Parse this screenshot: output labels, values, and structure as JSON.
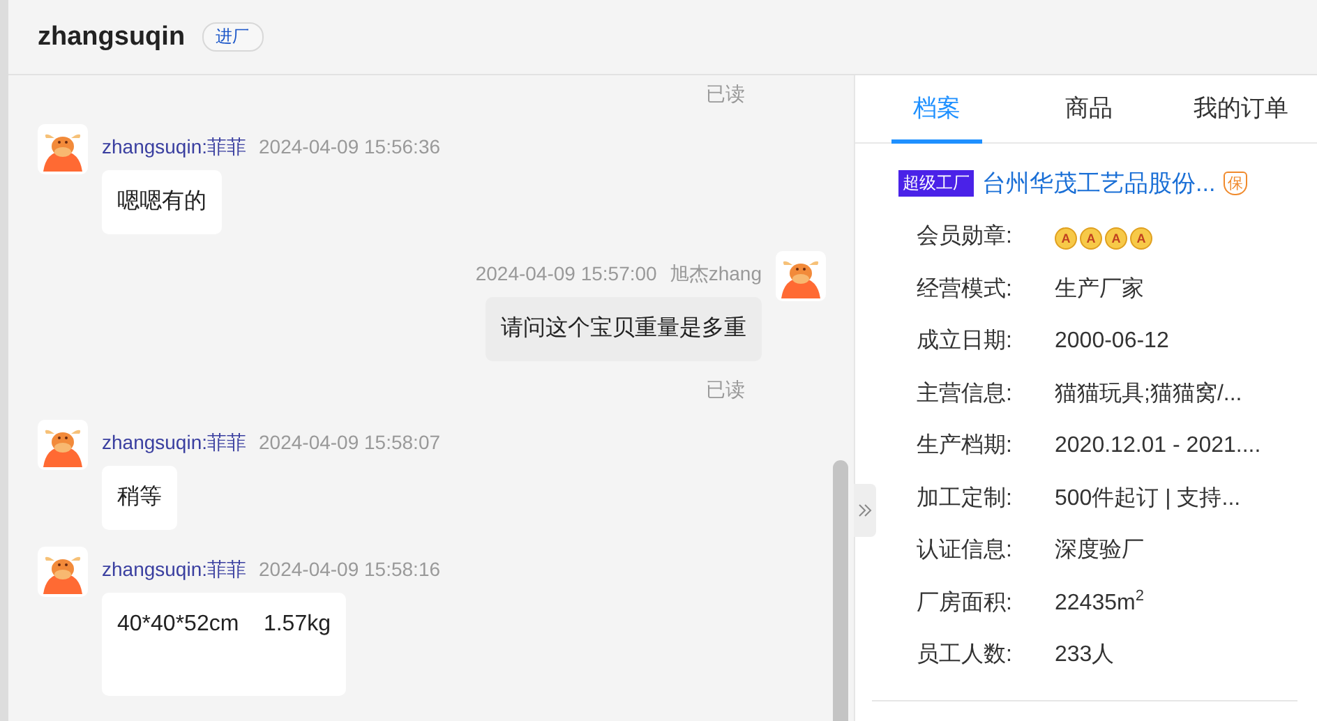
{
  "header": {
    "name": "zhangsuqin",
    "tag": "进厂"
  },
  "messages": [
    {
      "kind": "status",
      "text": "已读"
    },
    {
      "kind": "incoming",
      "sender": "zhangsuqin:菲菲",
      "time": "2024-04-09 15:56:36",
      "text": "嗯嗯有的"
    },
    {
      "kind": "outgoing",
      "sender": "旭杰zhang",
      "time": "2024-04-09 15:57:00",
      "text": "请问这个宝贝重量是多重"
    },
    {
      "kind": "status",
      "text": "已读"
    },
    {
      "kind": "incoming",
      "sender": "zhangsuqin:菲菲",
      "time": "2024-04-09 15:58:07",
      "text": "稍等"
    },
    {
      "kind": "incoming",
      "sender": "zhangsuqin:菲菲",
      "time": "2024-04-09 15:58:16",
      "text": "40*40*52cm    1.57kg"
    }
  ],
  "tabs": [
    {
      "label": "档案",
      "selected": true
    },
    {
      "label": "商品",
      "selected": false
    },
    {
      "label": "我的订单",
      "selected": false
    }
  ],
  "company": {
    "badge": "超级工厂",
    "name": "台州华茂工艺品股份...",
    "mark": "保"
  },
  "fields": [
    {
      "kind": "medals",
      "label": "会员勋章:",
      "medals": [
        "A",
        "A",
        "A",
        "A"
      ]
    },
    {
      "kind": "text",
      "label": "经营模式:",
      "value": "生产厂家"
    },
    {
      "kind": "text",
      "label": "成立日期:",
      "value": "2000-06-12"
    },
    {
      "kind": "text",
      "label": "主营信息:",
      "value": "猫猫玩具;猫猫窝/..."
    },
    {
      "kind": "text",
      "label": "生产档期:",
      "value": "2020.12.01 - 2021...."
    },
    {
      "kind": "text",
      "label": "加工定制:",
      "value": "500件起订 | 支持..."
    },
    {
      "kind": "text",
      "label": "认证信息:",
      "value": "深度验厂"
    },
    {
      "kind": "text",
      "label": "厂房面积:",
      "value": "22435m$^{2}$"
    },
    {
      "kind": "text",
      "label": "员工人数:",
      "value": "233人"
    }
  ]
}
